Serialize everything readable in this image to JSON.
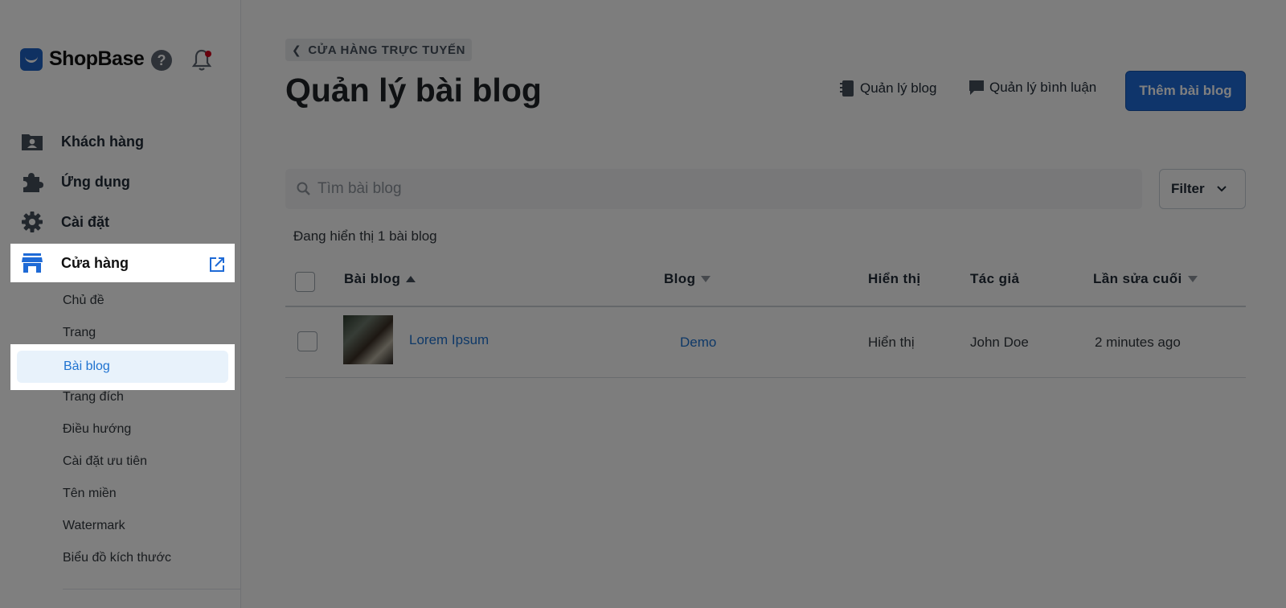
{
  "brand": {
    "name": "ShopBase",
    "help_glyph": "?",
    "icons": [
      "help-icon",
      "bell-icon"
    ],
    "notification_color": "#d0021b"
  },
  "sidebar": {
    "items": [
      {
        "label": "Khách hàng",
        "icon": "customer-icon"
      },
      {
        "label": "Ứng dụng",
        "icon": "puzzle-icon"
      },
      {
        "label": "Cài đặt",
        "icon": "gear-icon"
      },
      {
        "label": "Cửa hàng",
        "icon": "store-icon",
        "active": true,
        "trailing_icon": "external-link-icon"
      }
    ],
    "sub_items": [
      {
        "label": "Chủ đề"
      },
      {
        "label": "Trang"
      },
      {
        "label": "Bài blog",
        "active": true
      },
      {
        "label": "Trang đích"
      },
      {
        "label": "Điều hướng"
      },
      {
        "label": "Cài đặt ưu tiên"
      },
      {
        "label": "Tên miền"
      },
      {
        "label": "Watermark"
      },
      {
        "label": "Biểu đồ kích thước"
      }
    ]
  },
  "header": {
    "breadcrumb": "CỬA HÀNG TRỰC TUYẾN",
    "title": "Quản lý bài blog",
    "links": [
      {
        "label": "Quản lý blog",
        "icon": "notebook-icon"
      },
      {
        "label": "Quản lý bình luận",
        "icon": "comment-icon"
      }
    ],
    "primary_button": "Thêm bài blog"
  },
  "search": {
    "placeholder": "Tìm bài blog",
    "value": ""
  },
  "filter": {
    "label": "Filter"
  },
  "summary": "Đang hiển thị 1 bài blog",
  "table": {
    "columns": [
      {
        "label": "Bài blog",
        "sort": "asc"
      },
      {
        "label": "Blog",
        "sort": "desc"
      },
      {
        "label": "Hiển thị"
      },
      {
        "label": "Tác giả"
      },
      {
        "label": "Lần sửa cuối",
        "sort": "desc"
      }
    ],
    "rows": [
      {
        "title": "Lorem Ipsum",
        "blog": "Demo",
        "visibility": "Hiển thị",
        "author": "John Doe",
        "updated": "2 minutes ago"
      }
    ]
  },
  "theme": {
    "accent": "#1e6ad6",
    "link": "#1e72d0",
    "active_bg": "#e8f2fb"
  }
}
